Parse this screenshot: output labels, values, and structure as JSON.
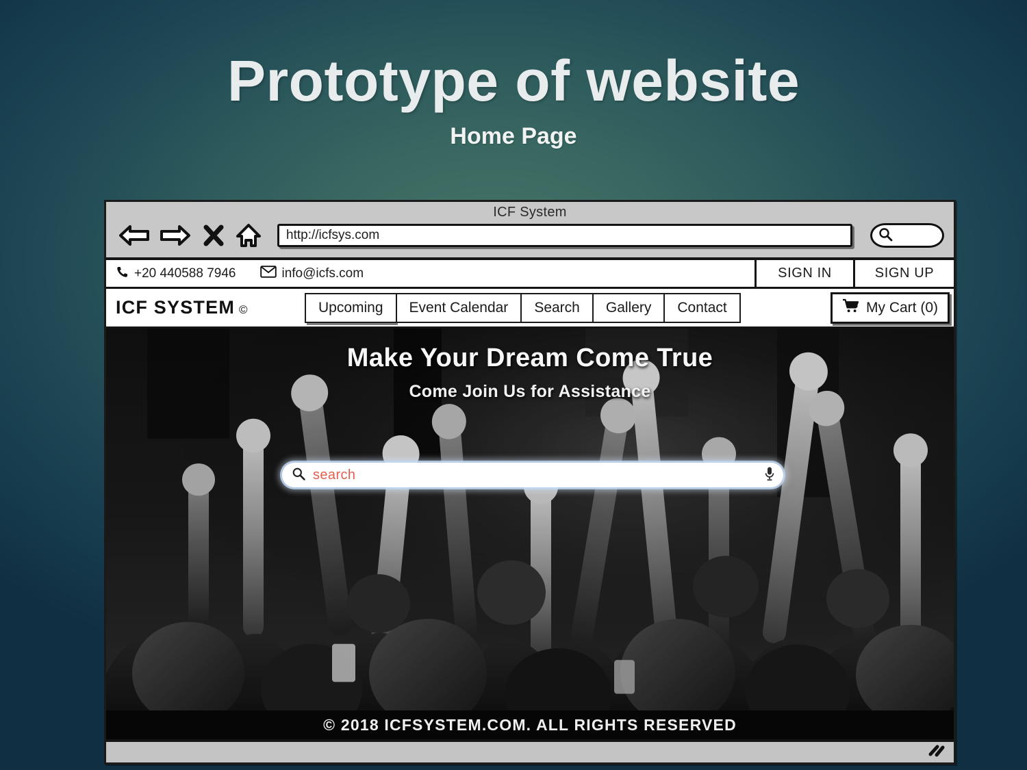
{
  "slide": {
    "title": "Prototype of website",
    "subtitle": "Home Page",
    "background_accent": "#3c6a62",
    "background_edge": "#123546"
  },
  "browser": {
    "window_title": "ICF System",
    "toolbar": {
      "back_icon": "back-arrow-icon",
      "forward_icon": "forward-arrow-icon",
      "stop_icon": "close-x-icon",
      "home_icon": "home-icon",
      "url_value": "http://icfsys.com",
      "url_placeholder": "http://",
      "browser_search_icon": "search-icon"
    },
    "status_bar": {
      "resize_grip_icon": "resize-grip-icon"
    }
  },
  "site": {
    "contact_bar": {
      "phone_icon": "phone-icon",
      "phone": "+20 440588 7946",
      "email_icon": "envelope-icon",
      "email": "info@icfs.com",
      "sign_in": "SIGN IN",
      "sign_up": "SIGN UP"
    },
    "logo": {
      "text": "ICF SYSTEM",
      "mark": "©",
      "mark_icon": "copyright-icon"
    },
    "nav_tabs": [
      {
        "label": "Upcoming"
      },
      {
        "label": "Event Calendar"
      },
      {
        "label": "Search"
      },
      {
        "label": "Gallery"
      },
      {
        "label": "Contact"
      }
    ],
    "cart": {
      "icon": "shopping-cart-icon",
      "label": "My Cart (0)",
      "count": 0
    },
    "hero": {
      "title": "Make Your Dream Come True",
      "subtitle": "Come Join Us for Assistance",
      "search": {
        "icon": "search-icon",
        "placeholder": "search",
        "value": "",
        "placeholder_color": "#e2604f",
        "mic_icon": "microphone-icon"
      },
      "image_alt": "black-and-white crowd with raised fists"
    },
    "footer": {
      "text": "© 2018 ICFSYSTEM.COM. ALL RIGHTS RESERVED"
    }
  }
}
